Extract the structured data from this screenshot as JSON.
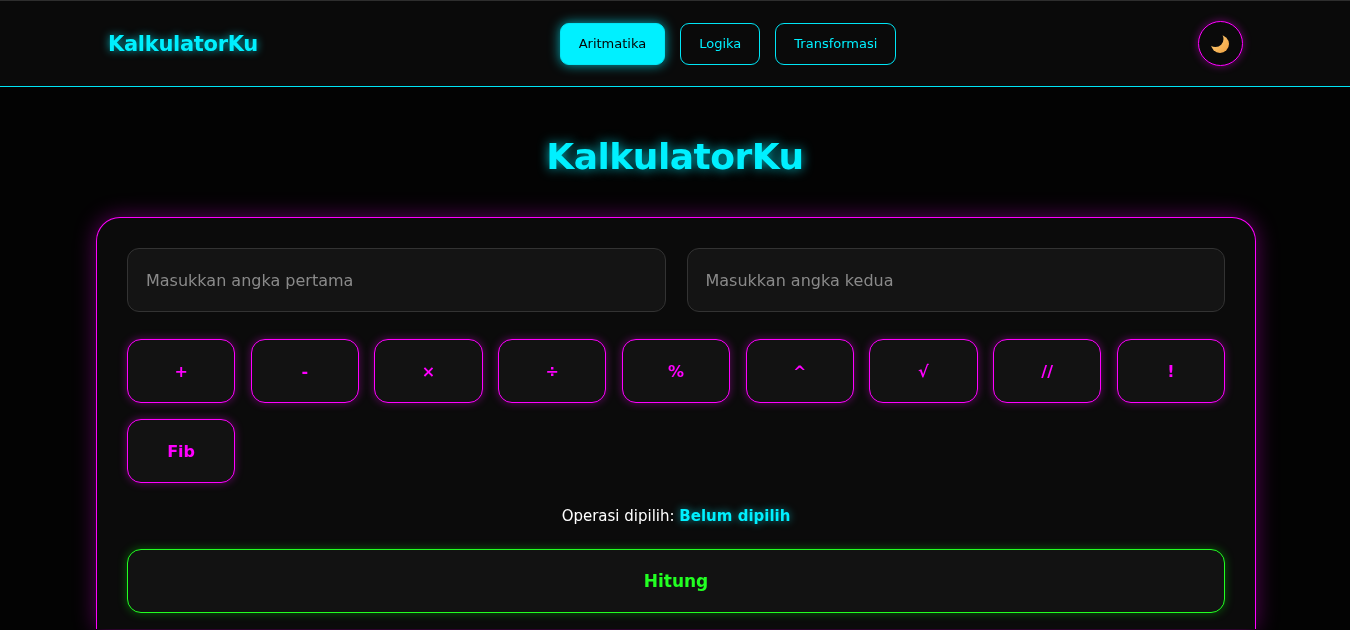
{
  "header": {
    "logo": "KalkulatorKu",
    "tabs": [
      {
        "label": "Aritmatika",
        "selected": true
      },
      {
        "label": "Logika",
        "selected": false
      },
      {
        "label": "Transformasi",
        "selected": false
      }
    ]
  },
  "page_title": "KalkulatorKu",
  "form": {
    "inputs": [
      {
        "placeholder": "Masukkan angka pertama"
      },
      {
        "placeholder": "Masukkan angka kedua"
      }
    ],
    "operations": [
      {
        "label": "+"
      },
      {
        "label": "-"
      },
      {
        "label": "×"
      },
      {
        "label": "÷"
      },
      {
        "label": "%"
      },
      {
        "label": "^"
      },
      {
        "label": "√"
      },
      {
        "label": "//"
      },
      {
        "label": "!"
      },
      {
        "label": "Fib"
      }
    ],
    "selected_operation": {
      "label": "Operasi dipilih:",
      "value": "Belum dipilih"
    },
    "submit": "Hitung"
  }
}
